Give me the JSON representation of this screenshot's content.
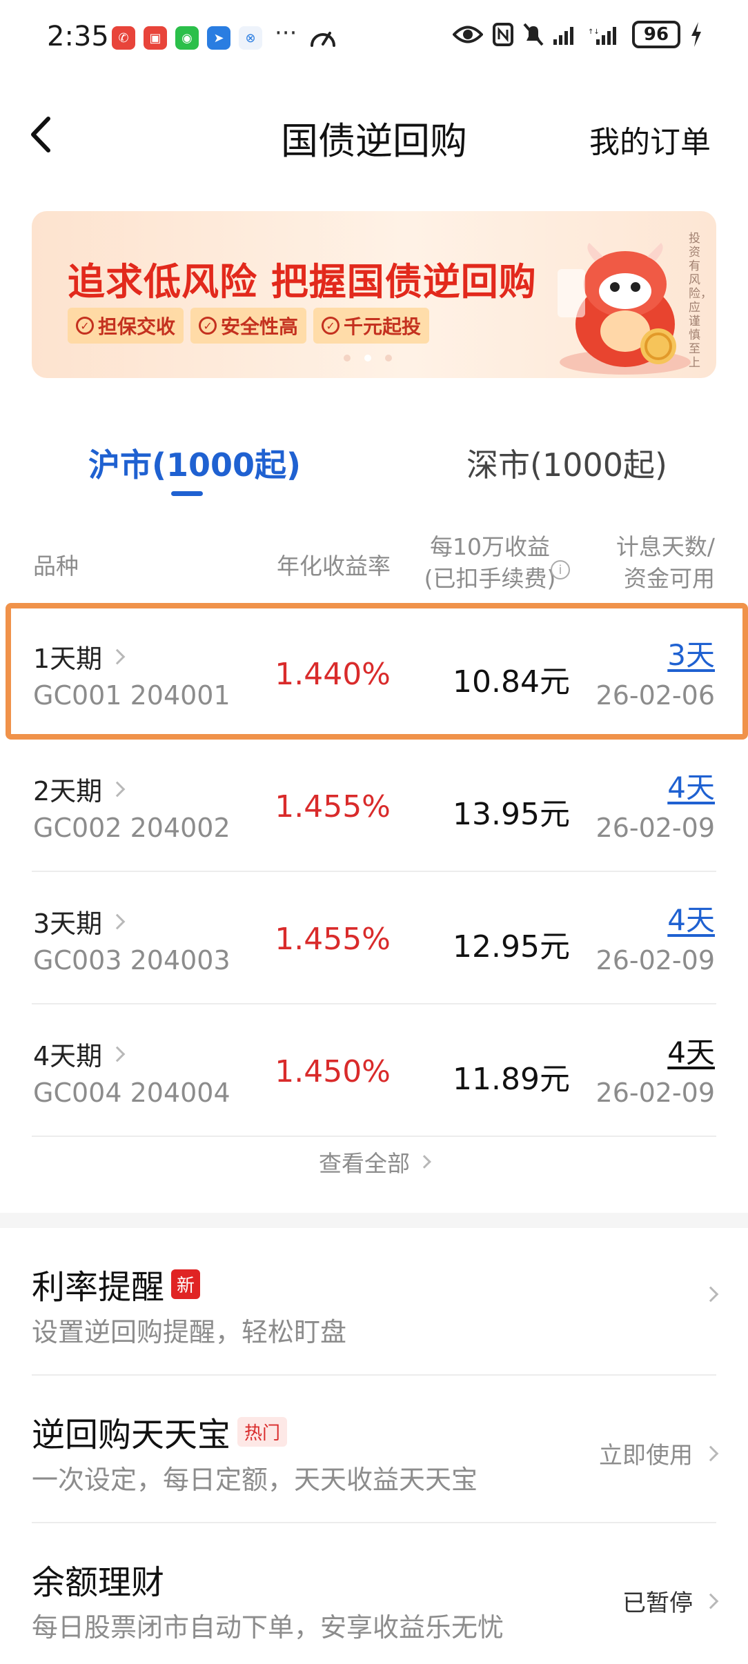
{
  "status_bar": {
    "time": "2:35",
    "battery": "96",
    "app_icons": [
      "missed-call-icon",
      "huawei-icon",
      "wechat-icon",
      "feishu-icon",
      "link-icon"
    ],
    "more": "···"
  },
  "nav": {
    "title": "国债逆回购",
    "orders_label": "我的订单"
  },
  "banner": {
    "headline": "追求低风险 把握国债逆回购",
    "features": [
      "担保交收",
      "安全性高",
      "千元起投"
    ],
    "side_note": "投资有风险，应谨慎至上"
  },
  "tabs": {
    "sh": "沪市(1000起)",
    "sz": "深市(1000起)"
  },
  "table": {
    "headers": {
      "variety": "品种",
      "rate": "年化收益率",
      "earn_line1": "每10万收益",
      "earn_line2": "(已扣手续费)",
      "days_line1": "计息天数/",
      "days_line2": "资金可用"
    },
    "rows": [
      {
        "name": "1天期",
        "code": "GC001 204001",
        "rate": "1.440%",
        "earn": "10.84元",
        "days": "3天",
        "date": "26-02-06"
      },
      {
        "name": "2天期",
        "code": "GC002 204002",
        "rate": "1.455%",
        "earn": "13.95元",
        "days": "4天",
        "date": "26-02-09"
      },
      {
        "name": "3天期",
        "code": "GC003 204003",
        "rate": "1.455%",
        "earn": "12.95元",
        "days": "4天",
        "date": "26-02-09"
      },
      {
        "name": "4天期",
        "code": "GC004 204004",
        "rate": "1.450%",
        "earn": "11.89元",
        "days": "4天",
        "date": "26-02-09"
      }
    ],
    "view_all": "查看全部"
  },
  "features": [
    {
      "title": "利率提醒",
      "badge": "新",
      "subtitle": "设置逆回购提醒，轻松盯盘",
      "action": ""
    },
    {
      "title": "逆回购天天宝",
      "badge": "热门",
      "subtitle": "一次设定，每日定额，天天收益天天宝",
      "action": "立即使用"
    },
    {
      "title": "余额理财",
      "badge": "",
      "subtitle": "每日股票闭市自动下单，安享收益乐无忧",
      "action": "已暂停"
    }
  ],
  "colors": {
    "accent_blue": "#1f61d1",
    "rate_red": "#d92b2b",
    "highlight_orange": "#f0924a"
  }
}
